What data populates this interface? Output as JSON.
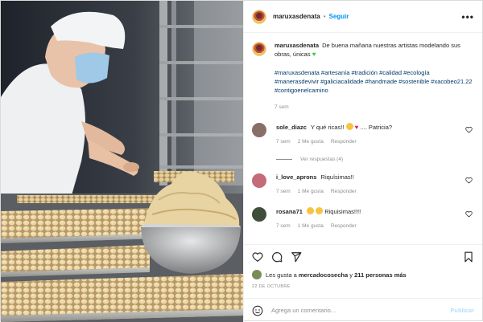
{
  "header": {
    "username": "maruxasdenata",
    "follow_label": "Seguir",
    "more_label": "•••"
  },
  "caption": {
    "username": "maruxasdenata",
    "text": "De buena mañana nuestras artistas modelando sus obras, únicas",
    "hashtags": "#maruxasdenata #artesanía #tradición #calidad #ecología #manerasdevivir #galiciacalidade #handmade #sostenible #xacobeo21.22 #contigoenelcamino",
    "time": "7 sem"
  },
  "comments": [
    {
      "username": "sole_diazc",
      "text_a": "Y qué ricas!!",
      "text_b": ".... Patricia?",
      "time": "7 sem",
      "likes": "2 Me gusta",
      "reply": "Responder",
      "avatar_color": "#8a6f66"
    },
    {
      "username": "i_love_aprons",
      "text_a": "Riquísimas!!",
      "time": "7 sem",
      "likes": "1 Me gusta",
      "reply": "Responder",
      "avatar_color": "#c46a78"
    },
    {
      "username": "rosana71",
      "text_a": "Riquisimas!!!!",
      "time": "7 sem",
      "likes": "1 Me gusta",
      "reply": "Responder",
      "avatar_color": "#3f4e3a"
    }
  ],
  "replies_label": "Ver respuestas (4)",
  "likes": {
    "prefix": "Les gusta a",
    "user": "mercadocosecha",
    "connector": "y",
    "others": "211 personas más"
  },
  "date": "22 DE OCTUBRE",
  "add_comment": {
    "placeholder": "Agrega un comentario...",
    "publish_label": "Publicar"
  },
  "colors": {
    "accent": "#0095f6",
    "text": "#262626",
    "muted": "#8e8e8e",
    "publish_disabled": "#b2dffc"
  }
}
